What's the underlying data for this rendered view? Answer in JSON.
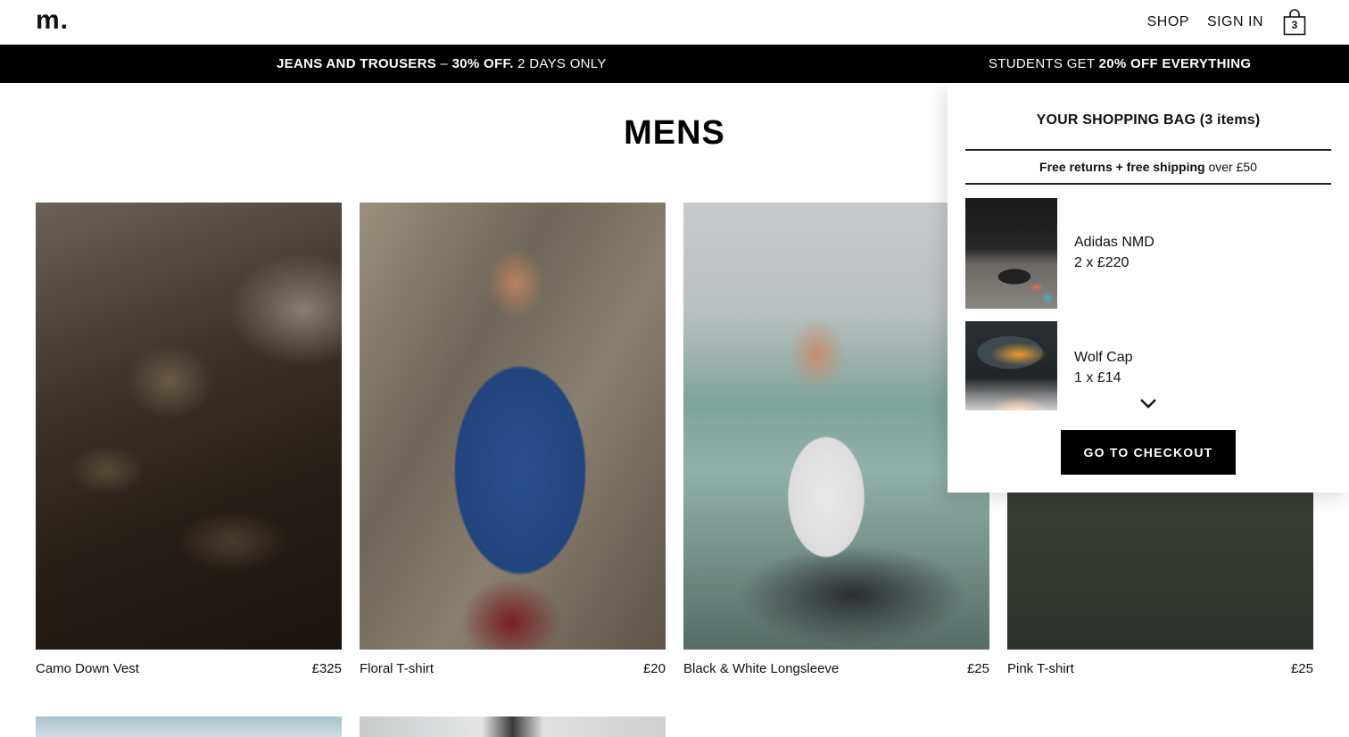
{
  "header": {
    "logo": "m.",
    "nav": {
      "shop": "SHOP",
      "sign_in": "SIGN IN"
    },
    "bag_count": "3"
  },
  "promo": {
    "left_bold": "JEANS AND TROUSERS",
    "left_dash": " – ",
    "left_offer": "30% OFF.",
    "left_rest": " 2 DAYS ONLY",
    "right_lead": "STUDENTS GET ",
    "right_bold": "20% OFF EVERYTHING"
  },
  "page": {
    "title": "MENS"
  },
  "products": [
    {
      "name": "Camo Down Vest",
      "price": "£325"
    },
    {
      "name": "Floral T-shirt",
      "price": "£20"
    },
    {
      "name": "Black & White Longsleeve",
      "price": "£25"
    },
    {
      "name": "Pink T-shirt",
      "price": "£25"
    }
  ],
  "bag": {
    "title": "YOUR SHOPPING BAG (3 items)",
    "shipping_bold": "Free returns + free shipping",
    "shipping_rest": " over £50",
    "items": [
      {
        "name": "Adidas NMD",
        "qty": "2 x £220"
      },
      {
        "name": "Wolf Cap",
        "qty": "1 x £14"
      }
    ],
    "checkout_label": "GO TO CHECKOUT"
  },
  "icons": {
    "bag": "shopping-bag-icon",
    "chevron": "chevron-down-icon"
  }
}
